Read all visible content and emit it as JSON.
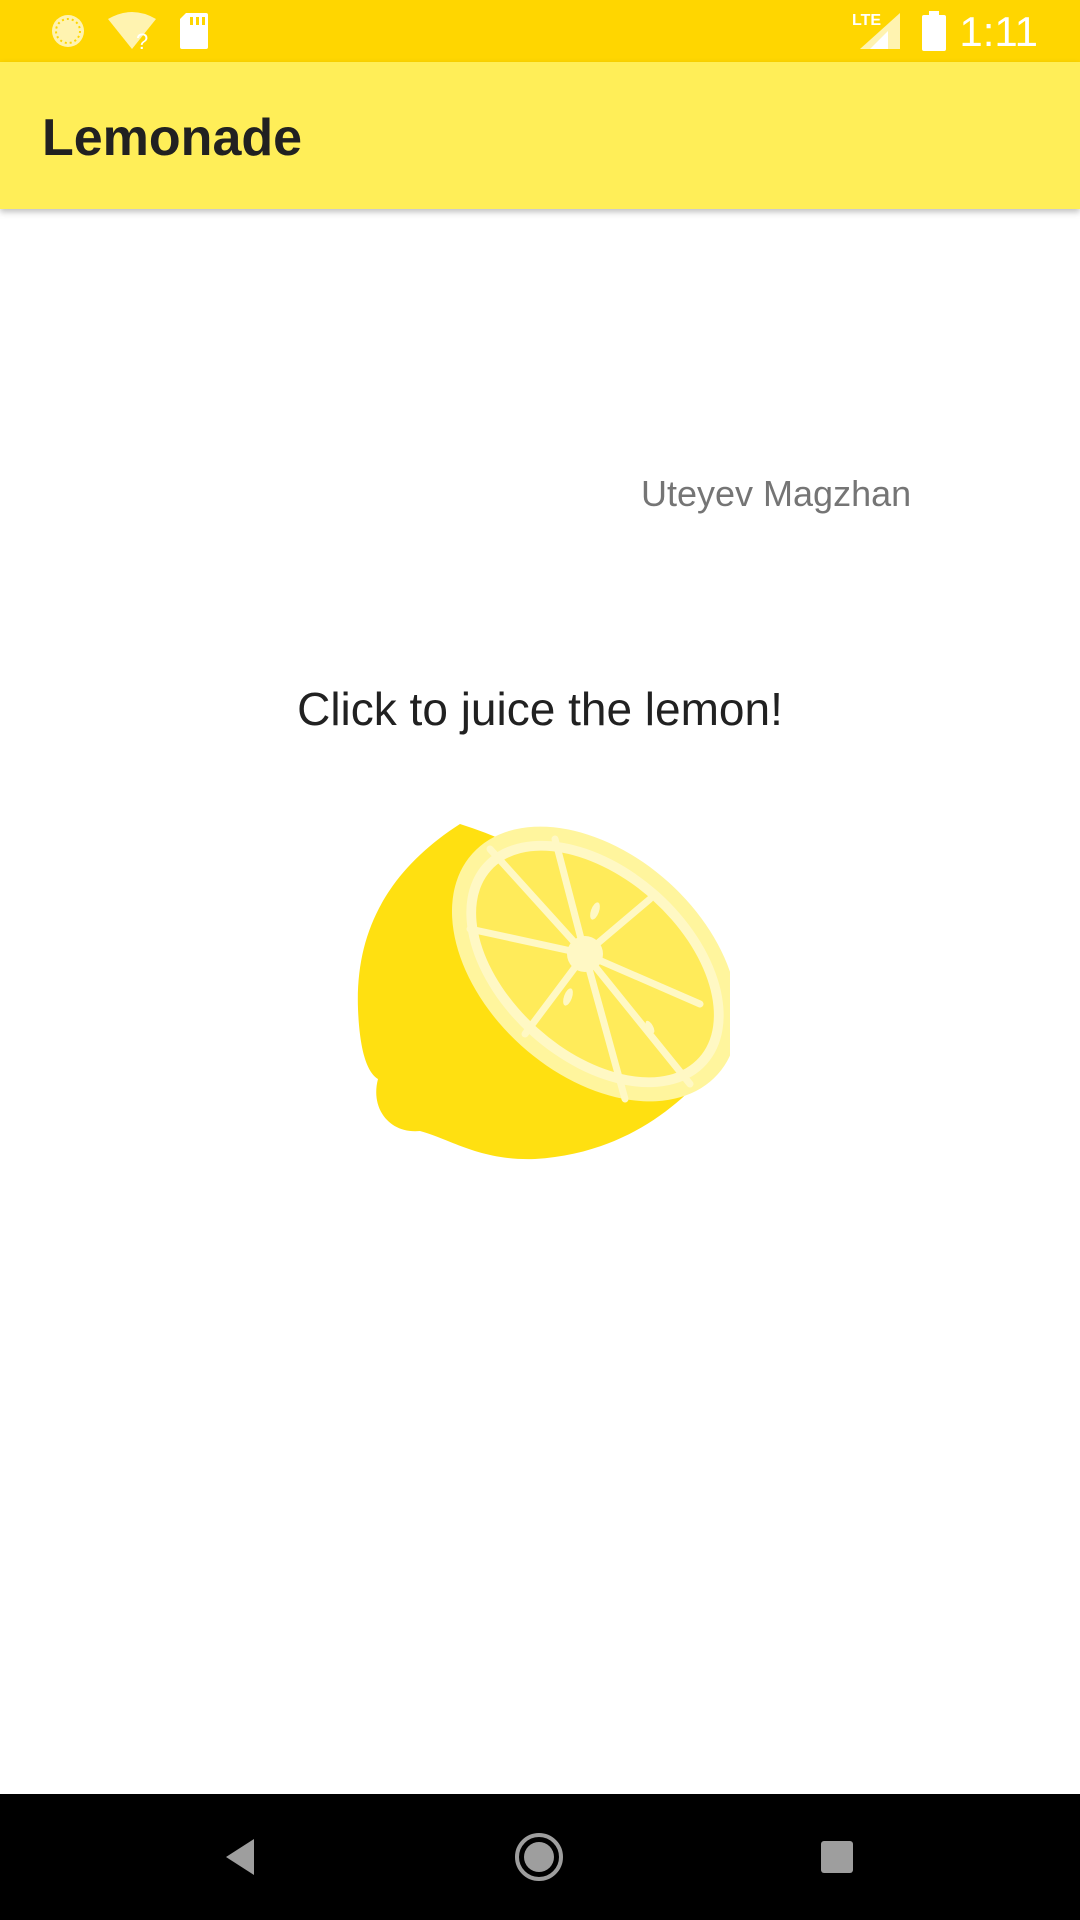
{
  "status_bar": {
    "time": "1:11",
    "network": "LTE",
    "wifi_status": "?",
    "background_color": "#FFD600"
  },
  "app_bar": {
    "title": "Lemonade",
    "background_color": "#FFEE58"
  },
  "main": {
    "author": "Uteyev Magzhan",
    "instruction": "Click to juice the lemon!",
    "image": "lemon-tree-icon"
  },
  "nav_bar": {
    "buttons": [
      "back-icon",
      "home-icon",
      "recents-icon"
    ]
  }
}
